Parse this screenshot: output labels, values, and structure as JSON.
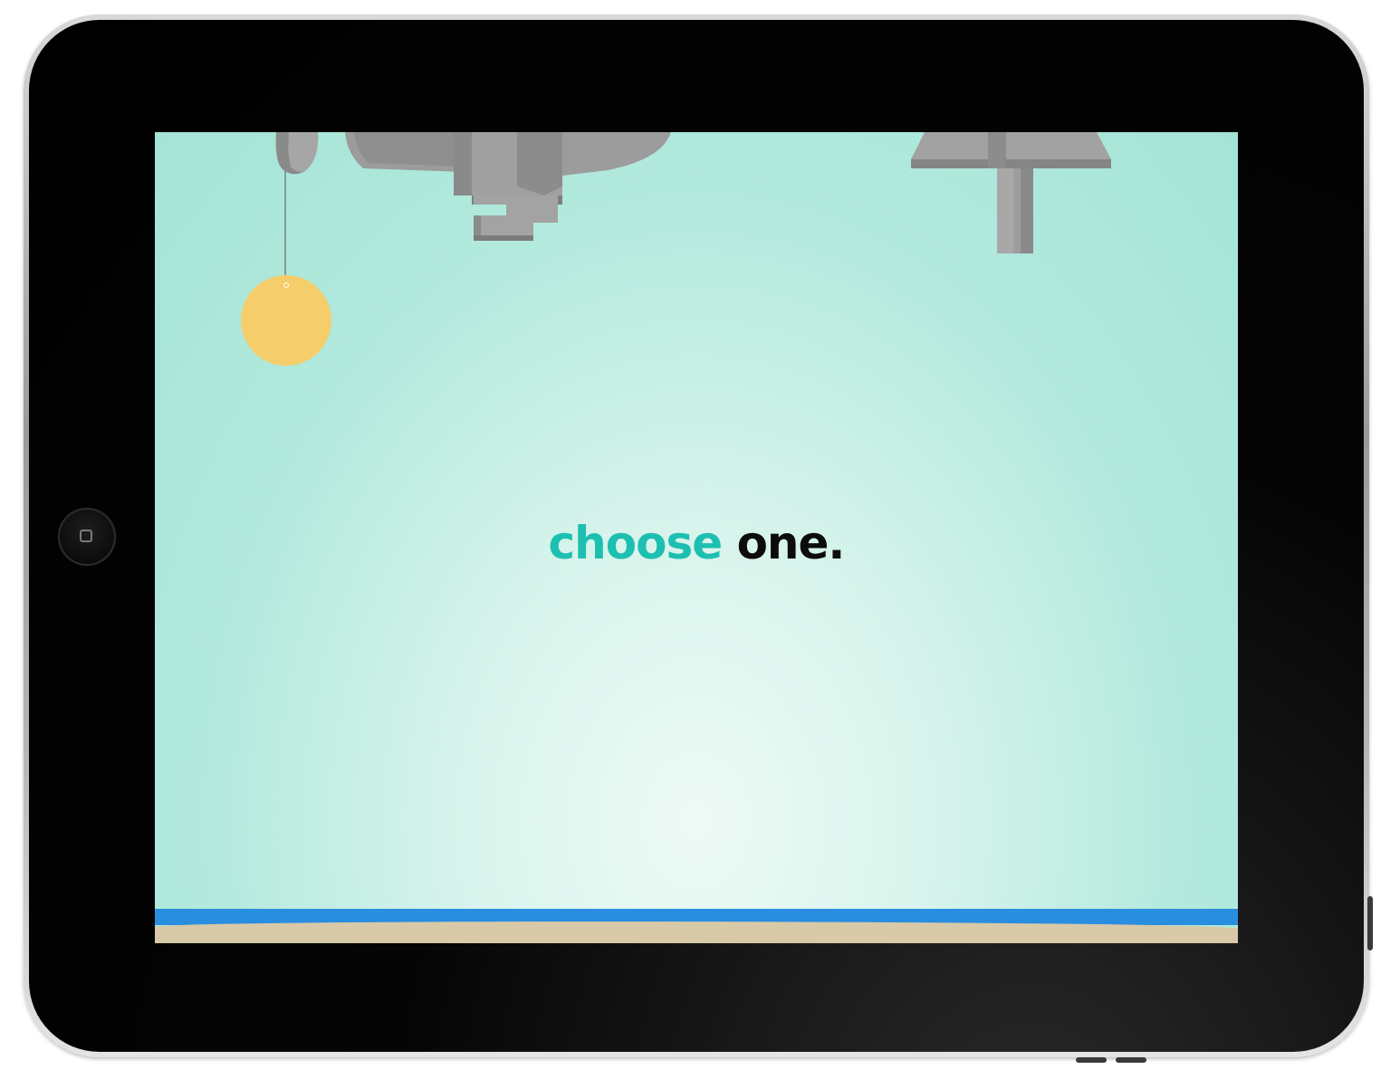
{
  "device": {
    "model": "tablet",
    "home_button_icon": "home-square-icon"
  },
  "screen": {
    "headline": {
      "word_1": "choose",
      "word_2": "one."
    },
    "colors": {
      "sky": "#a4e4d6",
      "accent_teal": "#1dbfb0",
      "headline_dark": "#0c0c0c",
      "sun": "#f5cd6a",
      "water": "#2a8ee0",
      "sand": "#d8c9a8",
      "stone": "#9c9c9c"
    },
    "icons": [
      "hanging-sun-icon",
      "stone-blocks-icon",
      "stone-tower-icon",
      "water-line",
      "sand-ground"
    ]
  }
}
